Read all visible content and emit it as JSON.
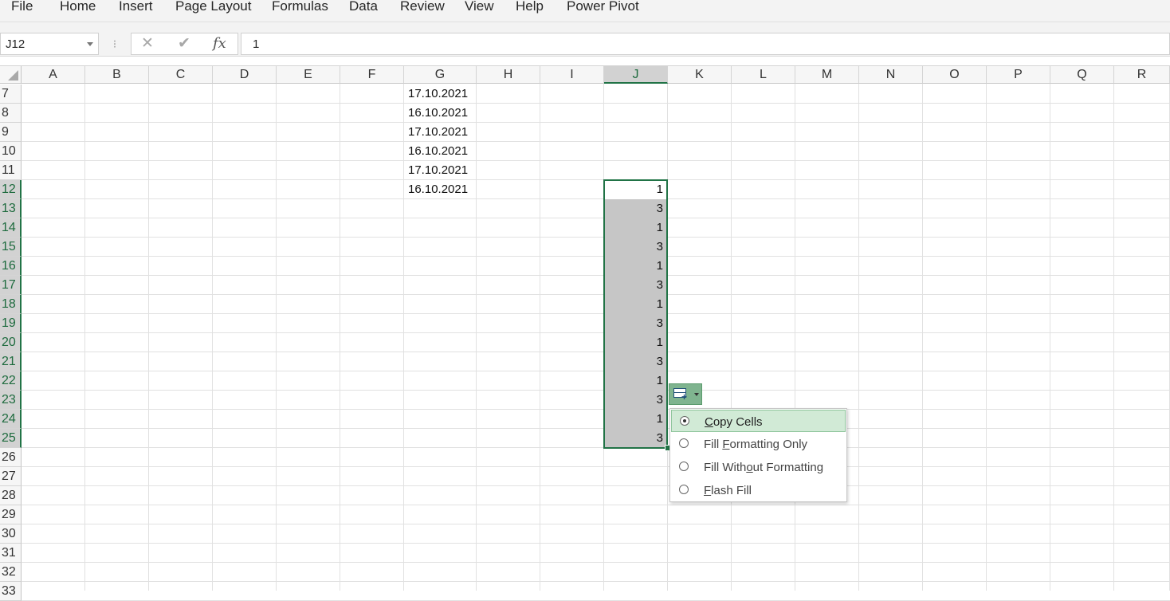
{
  "ribbon": {
    "tabs": [
      "File",
      "Home",
      "Insert",
      "Page Layout",
      "Formulas",
      "Data",
      "Review",
      "View",
      "Help",
      "Power Pivot"
    ]
  },
  "formula_bar": {
    "name_box": "J12",
    "separator": "⁝",
    "cancel_icon": "✕",
    "enter_icon": "✔",
    "fx_label": "fx",
    "formula": "1"
  },
  "columns": [
    "A",
    "B",
    "C",
    "D",
    "E",
    "F",
    "G",
    "H",
    "I",
    "J",
    "K",
    "L",
    "M",
    "N",
    "O",
    "P",
    "Q",
    "R"
  ],
  "selected_column": "J",
  "rows": [
    "7",
    "8",
    "9",
    "10",
    "11",
    "12",
    "13",
    "14",
    "15",
    "16",
    "17",
    "18",
    "19",
    "20",
    "21",
    "22",
    "23",
    "24",
    "25",
    "26",
    "27",
    "28",
    "29",
    "30",
    "31",
    "32",
    "33"
  ],
  "selected_rows": [
    "12",
    "13",
    "14",
    "15",
    "16",
    "17",
    "18",
    "19",
    "20",
    "21",
    "22",
    "23",
    "24",
    "25"
  ],
  "column_g": {
    "7": "17.10.2021",
    "8": "16.10.2021",
    "9": "17.10.2021",
    "10": "16.10.2021",
    "11": "17.10.2021",
    "12": "16.10.2021"
  },
  "column_j": {
    "12": "1",
    "13": "3",
    "14": "1",
    "15": "3",
    "16": "1",
    "17": "3",
    "18": "1",
    "19": "3",
    "20": "1",
    "21": "3",
    "22": "1",
    "23": "3",
    "24": "1",
    "25": "3"
  },
  "autofill_options": {
    "icon": "autofill-options-icon",
    "items": [
      {
        "pre": "",
        "u": "C",
        "post": "opy Cells",
        "selected": true
      },
      {
        "pre": "Fill ",
        "u": "F",
        "post": "ormatting Only",
        "selected": false
      },
      {
        "pre": "Fill With",
        "u": "o",
        "post": "ut Formatting",
        "selected": false
      },
      {
        "pre": "",
        "u": "F",
        "post": "lash Fill",
        "selected": false
      }
    ]
  },
  "colors": {
    "accent": "#217346",
    "selection_fill": "#c6c6c6",
    "menu_highlight": "#d1ead6"
  }
}
